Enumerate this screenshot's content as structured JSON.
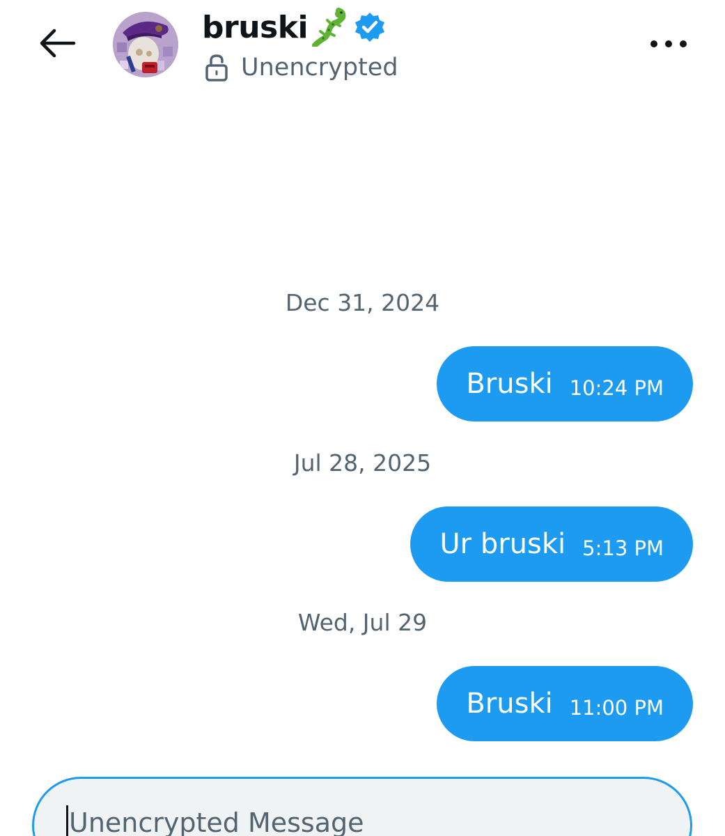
{
  "header": {
    "contact_name": "bruski",
    "encryption_status": "Unencrypted"
  },
  "icons": {
    "back": "back-arrow-icon",
    "avatar": "contact-avatar",
    "emoji": "lizard-emoji",
    "verified": "verified-badge-icon",
    "lock": "unlocked-lock-icon",
    "more": "more-options-icon"
  },
  "messages": [
    {
      "date": "Dec 31, 2024",
      "text": "Bruski",
      "time": "10:24 PM",
      "sender": "me"
    },
    {
      "date": "Jul 28, 2025",
      "text": "Ur bruski",
      "time": "5:13 PM",
      "sender": "me"
    },
    {
      "date": "Wed, Jul 29",
      "text": "Bruski",
      "time": "11:00 PM",
      "sender": "me"
    }
  ],
  "composer": {
    "placeholder": "Unencrypted Message",
    "value": ""
  },
  "colors": {
    "accent": "#1d9bf0",
    "text_primary": "#0f1419",
    "text_secondary": "#536471",
    "composer_bg": "#eff3f4"
  }
}
